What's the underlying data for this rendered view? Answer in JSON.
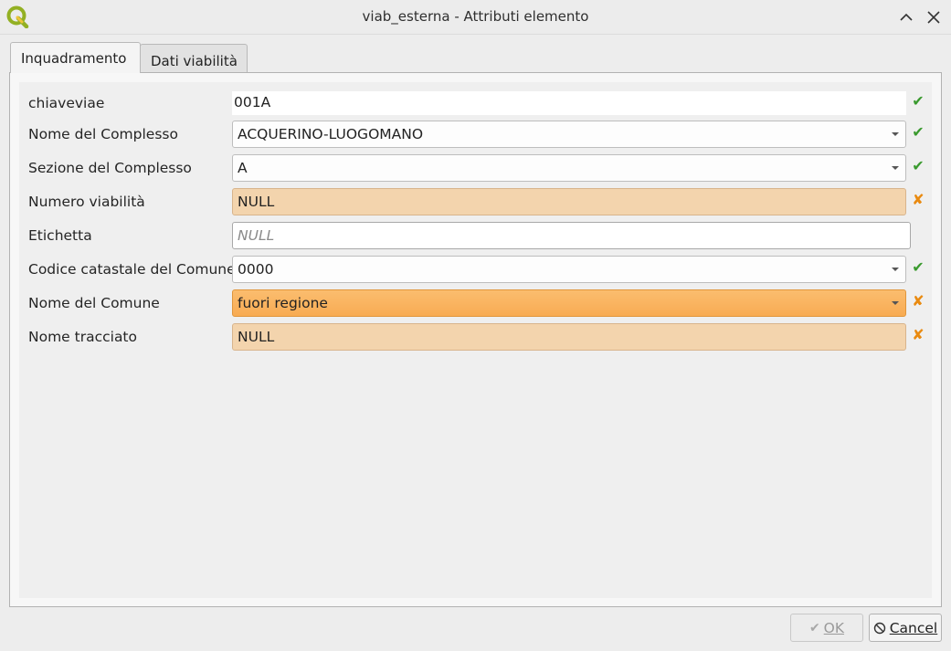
{
  "window": {
    "title": "viab_esterna - Attributi elemento"
  },
  "tabs": [
    {
      "label": "Inquadramento"
    },
    {
      "label": "Dati viabilità"
    }
  ],
  "fields": [
    {
      "label": "chiaveviae",
      "value": "001A",
      "status": "ok"
    },
    {
      "label": "Nome del Complesso",
      "value": "ACQUERINO-LUOGOMANO",
      "status": "ok"
    },
    {
      "label": "Sezione del Complesso",
      "value": "A",
      "status": "ok"
    },
    {
      "label": "Numero viabilità",
      "value": "NULL",
      "status": "error"
    },
    {
      "label": "Etichetta",
      "placeholder": "NULL"
    },
    {
      "label": "Codice catastale del Comune",
      "value": "0000",
      "status": "ok"
    },
    {
      "label": "Nome del Comune",
      "value": "fuori regione",
      "status": "error"
    },
    {
      "label": "Nome tracciato",
      "value": "NULL",
      "status": "error"
    }
  ],
  "status_glyphs": {
    "ok": "✔",
    "error": "✘"
  },
  "buttons": {
    "ok": {
      "label": "OK",
      "enabled": false
    },
    "cancel": {
      "label": "Cancel",
      "enabled": true
    }
  },
  "colors": {
    "ok_check": "#3a9a2e",
    "error_mark": "#e98a10",
    "error_field": "#f3d4ad",
    "error_combo": "#f8ab52"
  }
}
